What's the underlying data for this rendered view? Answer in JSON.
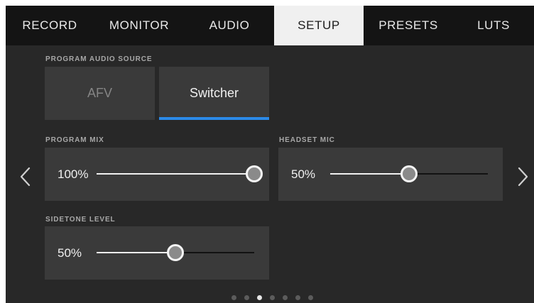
{
  "tabs": [
    {
      "label": "RECORD",
      "active": false
    },
    {
      "label": "MONITOR",
      "active": false
    },
    {
      "label": "AUDIO",
      "active": false
    },
    {
      "label": "SETUP",
      "active": true
    },
    {
      "label": "PRESETS",
      "active": false
    },
    {
      "label": "LUTS",
      "active": false
    }
  ],
  "program_audio_source": {
    "label": "PROGRAM AUDIO SOURCE",
    "options": [
      "AFV",
      "Switcher"
    ],
    "selected": "Switcher"
  },
  "program_mix": {
    "label": "PROGRAM MIX",
    "value_text": "100%",
    "level": 1.0
  },
  "headset_mic": {
    "label": "HEADSET MIC",
    "value_text": "50%",
    "level": 0.5
  },
  "sidetone_level": {
    "label": "SIDETONE LEVEL",
    "value_text": "50%",
    "level": 0.5
  },
  "navigation": {
    "prev_icon": "chevron-left-icon",
    "next_icon": "chevron-right-icon"
  },
  "pagination": {
    "total_pages": 7,
    "current_page": 3
  },
  "colors": {
    "accent": "#2b8ae8",
    "background": "#282828",
    "panel": "#3a3a3a",
    "tab_bar": "#141414",
    "active_tab": "#f0f0f0"
  }
}
